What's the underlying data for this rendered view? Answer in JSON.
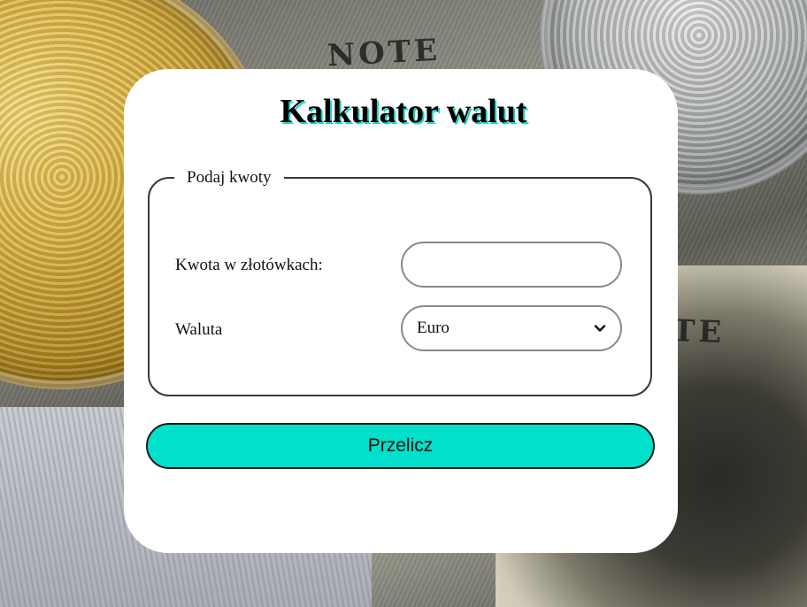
{
  "page": {
    "title": "Kalkulator walut"
  },
  "form": {
    "legend": "Podaj kwoty",
    "amount_label": "Kwota w złotówkach:",
    "amount_value": "",
    "currency_label": "Waluta",
    "currency_selected": "Euro",
    "submit_label": "Przelicz"
  },
  "colors": {
    "accent": "#00e0ca",
    "title_shadow": "#18d6c8",
    "card_background": "#ffffff"
  },
  "icons": {
    "select_arrow": "chevron-down-icon"
  }
}
